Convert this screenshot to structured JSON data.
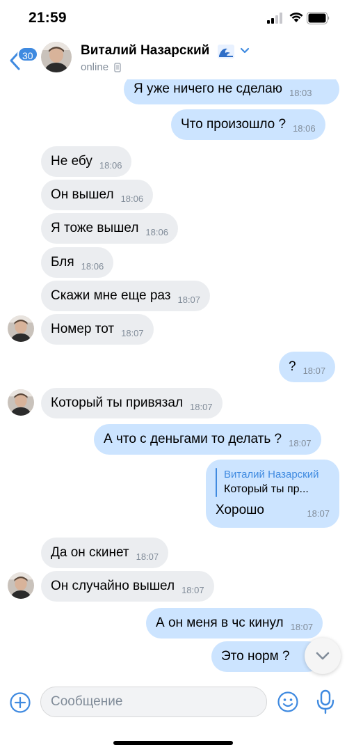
{
  "status_bar": {
    "time": "21:59"
  },
  "header": {
    "unread_count": "30",
    "contact_name": "Виталий Назарский",
    "contact_status": "online"
  },
  "messages": [
    {
      "dir": "out",
      "text": "Я уже ничего не сделаю",
      "time": "18:03"
    },
    {
      "dir": "out",
      "text": "Что произошло ?",
      "time": "18:06"
    },
    {
      "dir": "in",
      "text": "Не ебу",
      "time": "18:06"
    },
    {
      "dir": "in",
      "text": "Он вышел",
      "time": "18:06"
    },
    {
      "dir": "in",
      "text": "Я тоже вышел",
      "time": "18:06"
    },
    {
      "dir": "in",
      "text": "Бля",
      "time": "18:06"
    },
    {
      "dir": "in",
      "text": "Скажи мне еще раз",
      "time": "18:07"
    },
    {
      "dir": "in",
      "text": "Номер тот",
      "time": "18:07"
    },
    {
      "dir": "out",
      "text": "?",
      "time": "18:07"
    },
    {
      "dir": "in",
      "text": "Который ты привязал",
      "time": "18:07"
    },
    {
      "dir": "out",
      "text": "А что с деньгами то делать ?",
      "time": "18:07"
    },
    {
      "dir": "out",
      "reply_to_name": "Виталий Назарский",
      "reply_to_text": "Который ты пр...",
      "text": "Хорошо",
      "time": "18:07"
    },
    {
      "dir": "in",
      "text": "Да он скинет",
      "time": "18:07"
    },
    {
      "dir": "in",
      "text": "Он случайно вышел",
      "time": "18:07"
    },
    {
      "dir": "out",
      "text": "А он меня в чс кинул",
      "time": "18:07"
    },
    {
      "dir": "out",
      "text": "Это норм ?",
      "time": ""
    }
  ],
  "composer": {
    "placeholder": "Сообщение"
  },
  "colors": {
    "accent": "#3f8ae0",
    "incoming_bubble": "#ebedf0",
    "outgoing_bubble": "#cce4ff",
    "secondary_text": "#818c99"
  },
  "icons": [
    "signal-icon",
    "wifi-icon",
    "battery-icon",
    "back-icon",
    "wave-icon",
    "chevron-down-icon",
    "phone-icon",
    "plus-circle-icon",
    "emoji-icon",
    "microphone-icon",
    "chevron-down-icon"
  ]
}
